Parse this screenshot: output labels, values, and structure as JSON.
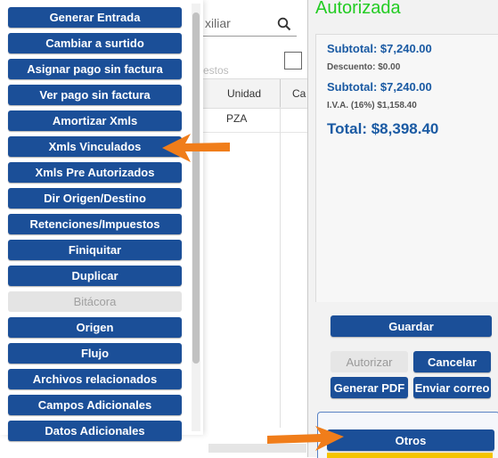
{
  "doc": {
    "search_text": "xiliar",
    "impuestos_text": "estos",
    "columns": [
      "Unidad",
      "Ca"
    ],
    "rows": [
      [
        "PZA"
      ]
    ]
  },
  "totals": {
    "status": "Autorizada",
    "subtotal1": "Subtotal: $7,240.00",
    "descuento": "Descuento: $0.00",
    "subtotal2": "Subtotal: $7,240.00",
    "iva": "I.V.A. (16%) $1,158.40",
    "total": "Total: $8,398.40"
  },
  "actions": {
    "guardar": "Guardar",
    "autorizar": "Autorizar",
    "cancelar": "Cancelar",
    "generar_pdf": "Generar PDF",
    "enviar_correo": "Enviar correo",
    "otros": "Otros"
  },
  "menu": {
    "items": [
      {
        "label": "Generar Entrada",
        "enabled": true
      },
      {
        "label": "Cambiar a surtido",
        "enabled": true
      },
      {
        "label": "Asignar pago sin factura",
        "enabled": true
      },
      {
        "label": "Ver pago sin factura",
        "enabled": true
      },
      {
        "label": "Amortizar Xmls",
        "enabled": true
      },
      {
        "label": "Xmls Vinculados",
        "enabled": true
      },
      {
        "label": "Xmls Pre Autorizados",
        "enabled": true
      },
      {
        "label": "Dir Origen/Destino",
        "enabled": true
      },
      {
        "label": "Retenciones/Impuestos",
        "enabled": true
      },
      {
        "label": "Finiquitar",
        "enabled": true
      },
      {
        "label": "Duplicar",
        "enabled": true
      },
      {
        "label": "Bitácora",
        "enabled": false
      },
      {
        "label": "Origen",
        "enabled": true
      },
      {
        "label": "Flujo",
        "enabled": true
      },
      {
        "label": "Archivos relacionados",
        "enabled": true
      },
      {
        "label": "Campos Adicionales",
        "enabled": true
      },
      {
        "label": "Datos Adicionales",
        "enabled": true
      }
    ]
  },
  "colors": {
    "button_blue": "#1b4f98",
    "status_green": "#22cc22",
    "total_blue": "#1a5aa3",
    "arrow_orange": "#f07d1a",
    "accent_yellow": "#f5c400"
  },
  "icons": {
    "search": "search-icon",
    "arrow": "orange-arrow-icon"
  }
}
